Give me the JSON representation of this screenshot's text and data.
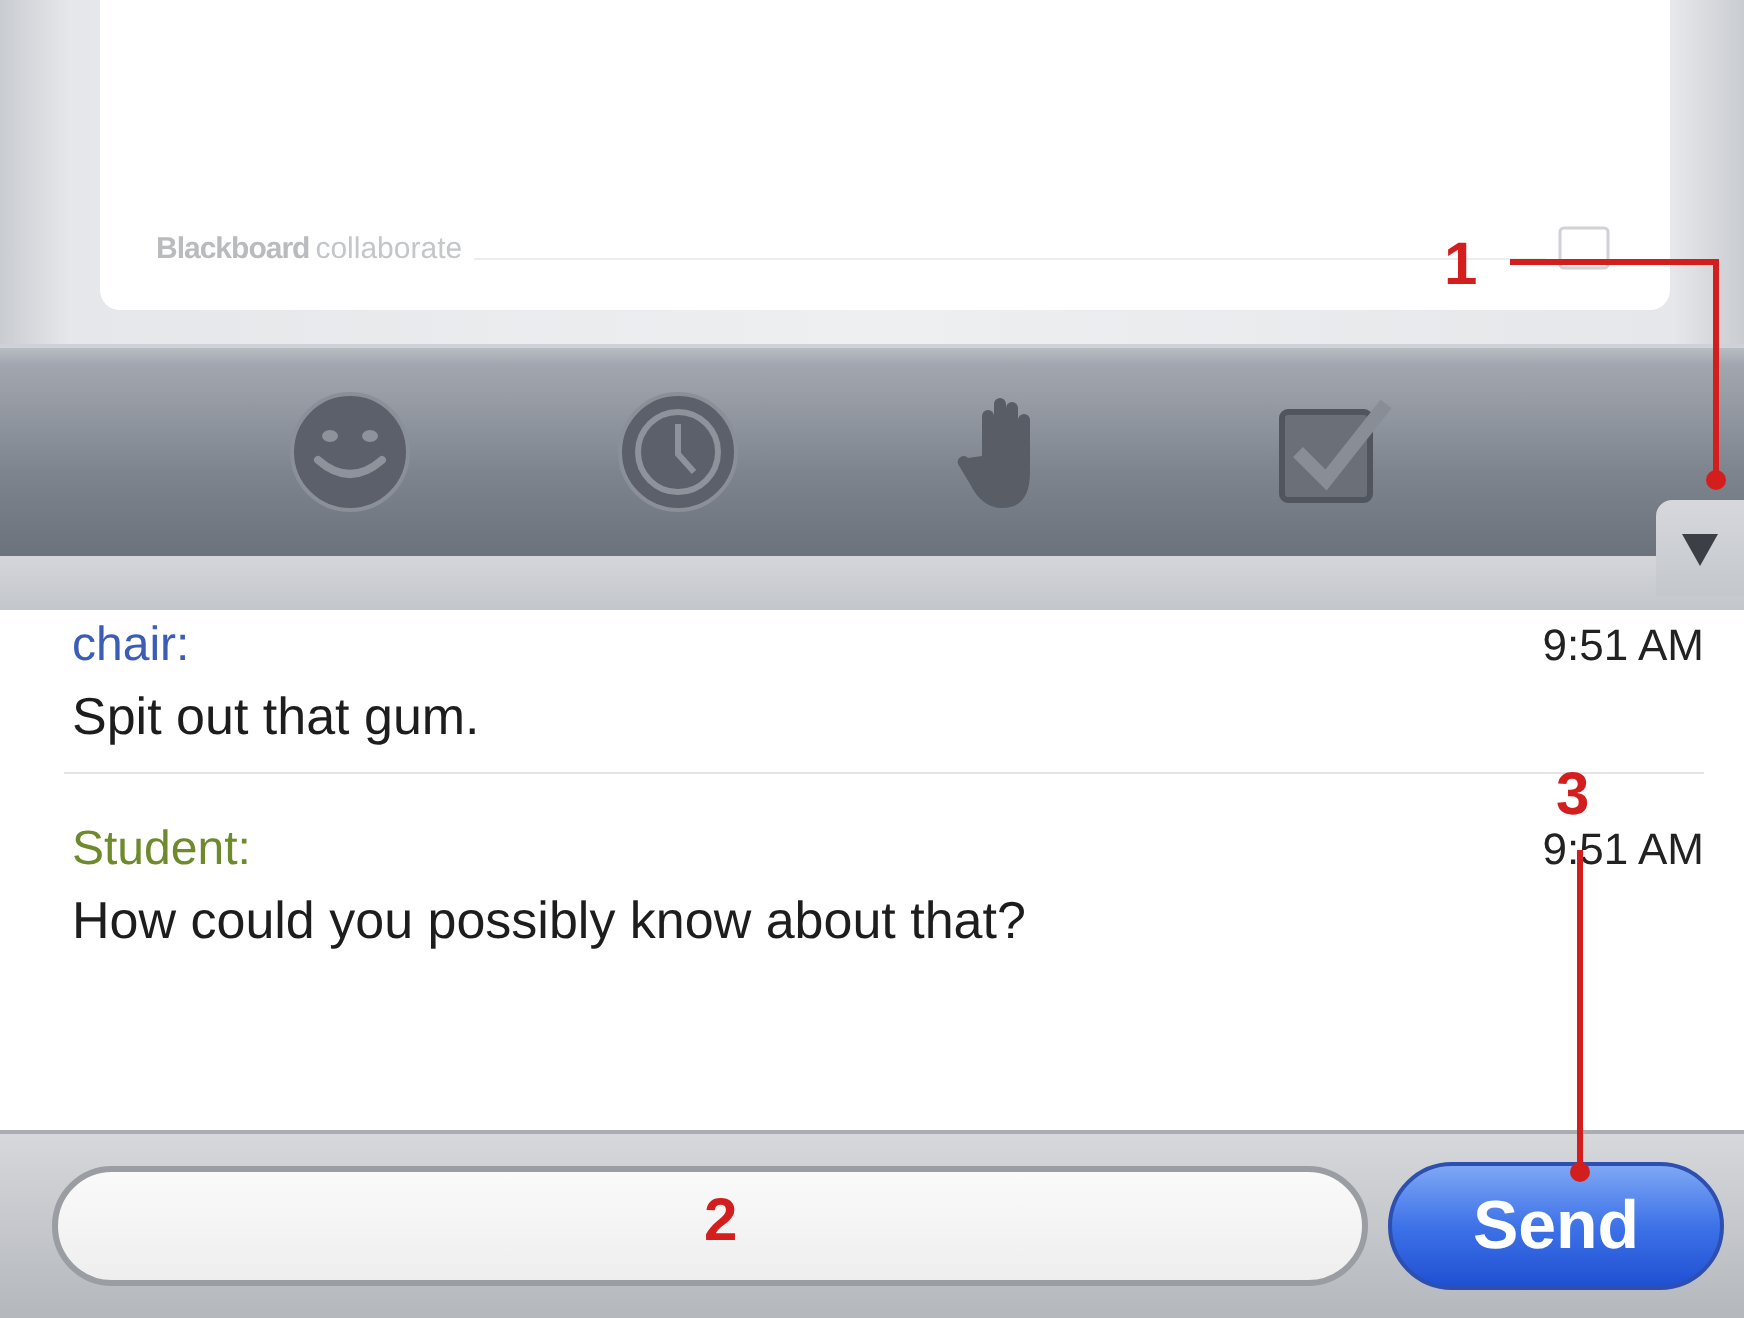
{
  "logo": {
    "brand": "Blackboard",
    "product": "collaborate"
  },
  "messages": [
    {
      "sender": "chair:",
      "time": "9:51 AM",
      "text": "Spit out that gum.",
      "color": "#3b5db5"
    },
    {
      "sender": "Student:",
      "time": "9:51 AM",
      "text": "How could you possibly know about that?",
      "color": "#6f8a2c"
    }
  ],
  "send_button": "Send",
  "annotations": [
    {
      "label": "1"
    },
    {
      "label": "2"
    },
    {
      "label": "3"
    }
  ]
}
